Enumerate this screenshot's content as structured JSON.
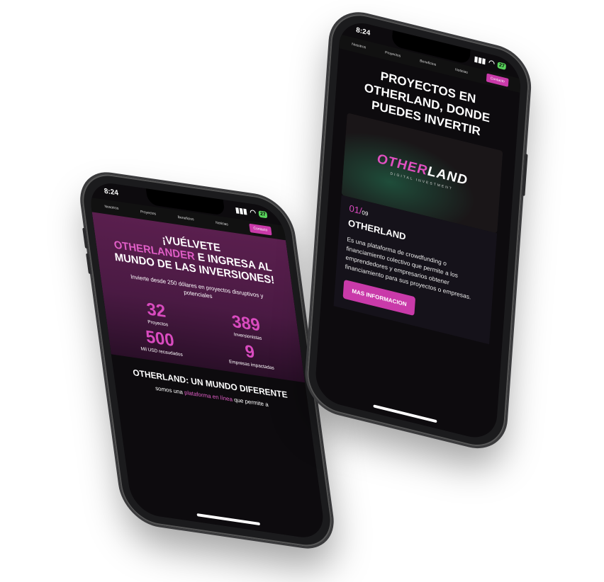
{
  "status": {
    "time": "8:24",
    "battery": "27"
  },
  "nav": {
    "items": [
      "Nosotros",
      "Proyectos",
      "Beneficios",
      "Noticias"
    ],
    "cta": "Contacto"
  },
  "hero": {
    "title_pre": "¡VUÉLVETE",
    "title_highlight": "OTHERLANDER",
    "title_post": "E INGRESA AL MUNDO DE LAS INVERSIONES!",
    "subtitle": "Invierte desde 250 dólares en proyectos disruptivos y potenciales",
    "stats": [
      {
        "value": "32",
        "label": "Proyectos"
      },
      {
        "value": "389",
        "label": "Inversionistas"
      },
      {
        "value": "500",
        "label": "Mil USD recaudados"
      },
      {
        "value": "9",
        "label": "Empresas impactadas"
      }
    ]
  },
  "section": {
    "title": "OTHERLAND: UN MUNDO DIFERENTE",
    "text_pre": "somos una",
    "text_link": "plataforma en línea",
    "text_post": "que permite a"
  },
  "projects": {
    "title": "PROYECTOS EN OTHERLAND, DONDE PUEDES INVERTIR",
    "logo_a": "OTHER",
    "logo_b": "LAND",
    "logo_sub": "DIGITAL INVESTMENT",
    "card": {
      "num": "01/",
      "total": "09",
      "name": "OTHERLAND",
      "text": "Es una plataforma de crowdfunding o financiamiento colectivo que permite a los emprendedores y empresarios obtener financiamiento para sus proyectos o empresas.",
      "button": "MAS INFORMACION"
    }
  }
}
